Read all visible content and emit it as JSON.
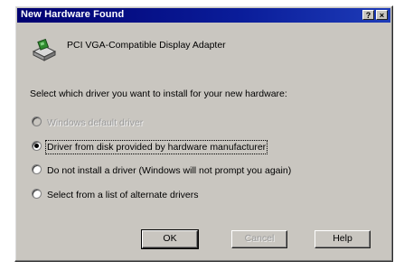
{
  "window": {
    "title": "New Hardware Found"
  },
  "titlebar_buttons": {
    "help": "?",
    "close": "×"
  },
  "device": {
    "name": "PCI VGA-Compatible Display Adapter",
    "icon": "hardware-icon"
  },
  "prompt": "Select which driver you want to install for your new hardware:",
  "options": [
    {
      "label": "Windows default driver",
      "checked": false,
      "disabled": true
    },
    {
      "label": "Driver from disk provided by hardware manufacturer",
      "checked": true,
      "disabled": false
    },
    {
      "label": "Do not install a driver (Windows will not prompt you again)",
      "checked": false,
      "disabled": false
    },
    {
      "label": "Select from a list of alternate drivers",
      "checked": false,
      "disabled": false
    }
  ],
  "buttons": {
    "ok": "OK",
    "cancel": "Cancel",
    "help": "Help"
  },
  "colors": {
    "titlebar": "#000070",
    "face": "#c9c6c0"
  }
}
